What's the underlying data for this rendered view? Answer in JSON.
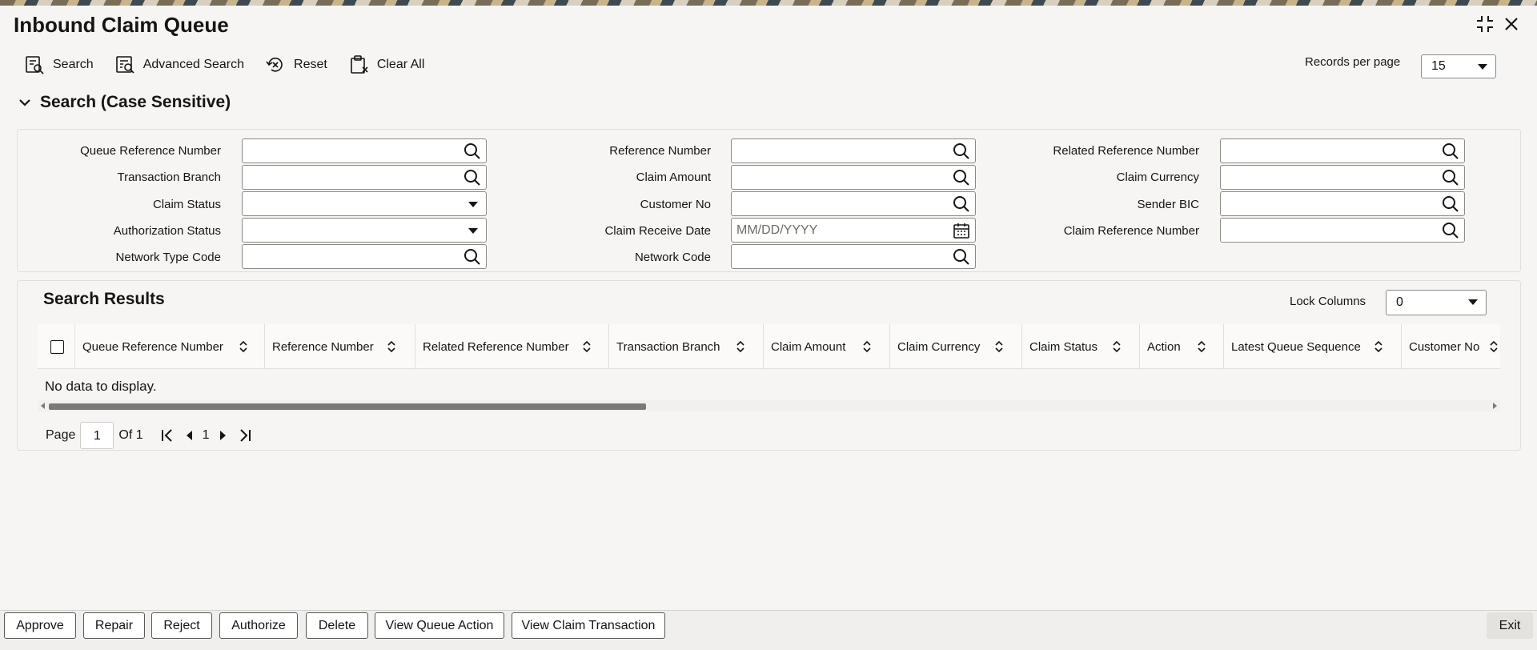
{
  "header": {
    "title": "Inbound Claim Queue"
  },
  "toolbar": {
    "search_label": "Search",
    "advanced_search_label": "Advanced Search",
    "reset_label": "Reset",
    "clear_all_label": "Clear All",
    "records_per_page_label": "Records per page",
    "records_per_page_value": "15"
  },
  "search_section": {
    "title": "Search (Case Sensitive)",
    "fields": {
      "queue_reference_number": "Queue Reference Number",
      "transaction_branch": "Transaction Branch",
      "claim_status": "Claim Status",
      "authorization_status": "Authorization Status",
      "network_type_code": "Network Type Code",
      "reference_number": "Reference Number",
      "claim_amount": "Claim Amount",
      "customer_no": "Customer No",
      "claim_receive_date": "Claim Receive Date",
      "claim_receive_date_placeholder": "MM/DD/YYYY",
      "network_code": "Network Code",
      "related_reference_number": "Related Reference Number",
      "claim_currency": "Claim Currency",
      "sender_bic": "Sender BIC",
      "claim_reference_number": "Claim Reference Number"
    }
  },
  "results": {
    "title": "Search Results",
    "lock_columns_label": "Lock Columns",
    "lock_columns_value": "0",
    "columns": [
      "Queue Reference Number",
      "Reference Number",
      "Related Reference Number",
      "Transaction Branch",
      "Claim Amount",
      "Claim Currency",
      "Claim Status",
      "Action",
      "Latest Queue Sequence",
      "Customer No"
    ],
    "empty_message": "No data to display."
  },
  "pager": {
    "page_label": "Page",
    "page_value": "1",
    "of_label": "Of 1",
    "current": "1"
  },
  "footer": {
    "buttons": [
      "Approve",
      "Repair",
      "Reject",
      "Authorize",
      "Delete",
      "View Queue Action",
      "View Claim Transaction"
    ],
    "exit_label": "Exit"
  }
}
